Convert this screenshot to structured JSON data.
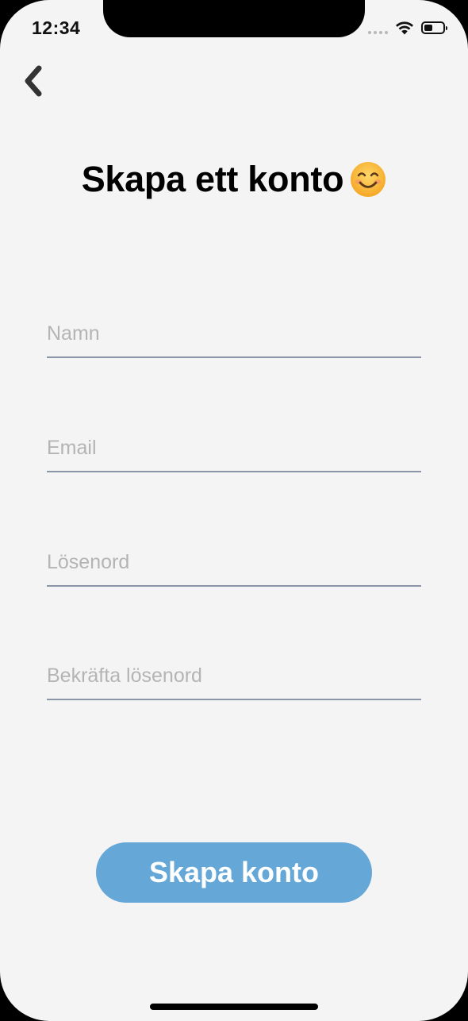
{
  "status_bar": {
    "time": "12:34",
    "battery_level": 0.45
  },
  "header": {
    "title": "Skapa ett konto",
    "title_emoji": "smiling-face-icon"
  },
  "form": {
    "name_placeholder": "Namn",
    "name_value": "",
    "email_placeholder": "Email",
    "email_value": "",
    "password_placeholder": "Lösenord",
    "password_value": "",
    "confirm_password_placeholder": "Bekräfta lösenord",
    "confirm_password_value": ""
  },
  "actions": {
    "submit_label": "Skapa konto"
  },
  "colors": {
    "background": "#f4f4f4",
    "button": "#65a8d8",
    "field_underline": "#8a96a8",
    "placeholder": "#b4b4b4"
  }
}
